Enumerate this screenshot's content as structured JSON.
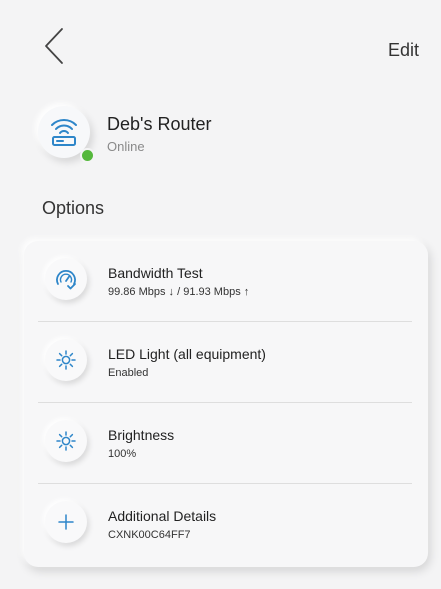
{
  "header": {
    "back_icon": "chevron-left-icon",
    "edit_label": "Edit"
  },
  "device": {
    "name": "Deb's Router",
    "status": "Online",
    "icon": "router-wifi-icon",
    "status_color": "#55b83c"
  },
  "section": {
    "title": "Options"
  },
  "options": [
    {
      "icon": "speedometer-icon",
      "title": "Bandwidth Test",
      "subtitle": "99.86 Mbps ↓ / 91.93 Mbps ↑"
    },
    {
      "icon": "sun-icon",
      "title": "LED Light (all equipment)",
      "subtitle": "Enabled"
    },
    {
      "icon": "sun-icon",
      "title": "Brightness",
      "subtitle": "100%"
    },
    {
      "icon": "plus-icon",
      "title": "Additional Details",
      "subtitle": "CXNK00C64FF7"
    }
  ],
  "colors": {
    "accent": "#2e86c9",
    "background": "#f4f4f5",
    "card": "#f7f7f8"
  }
}
